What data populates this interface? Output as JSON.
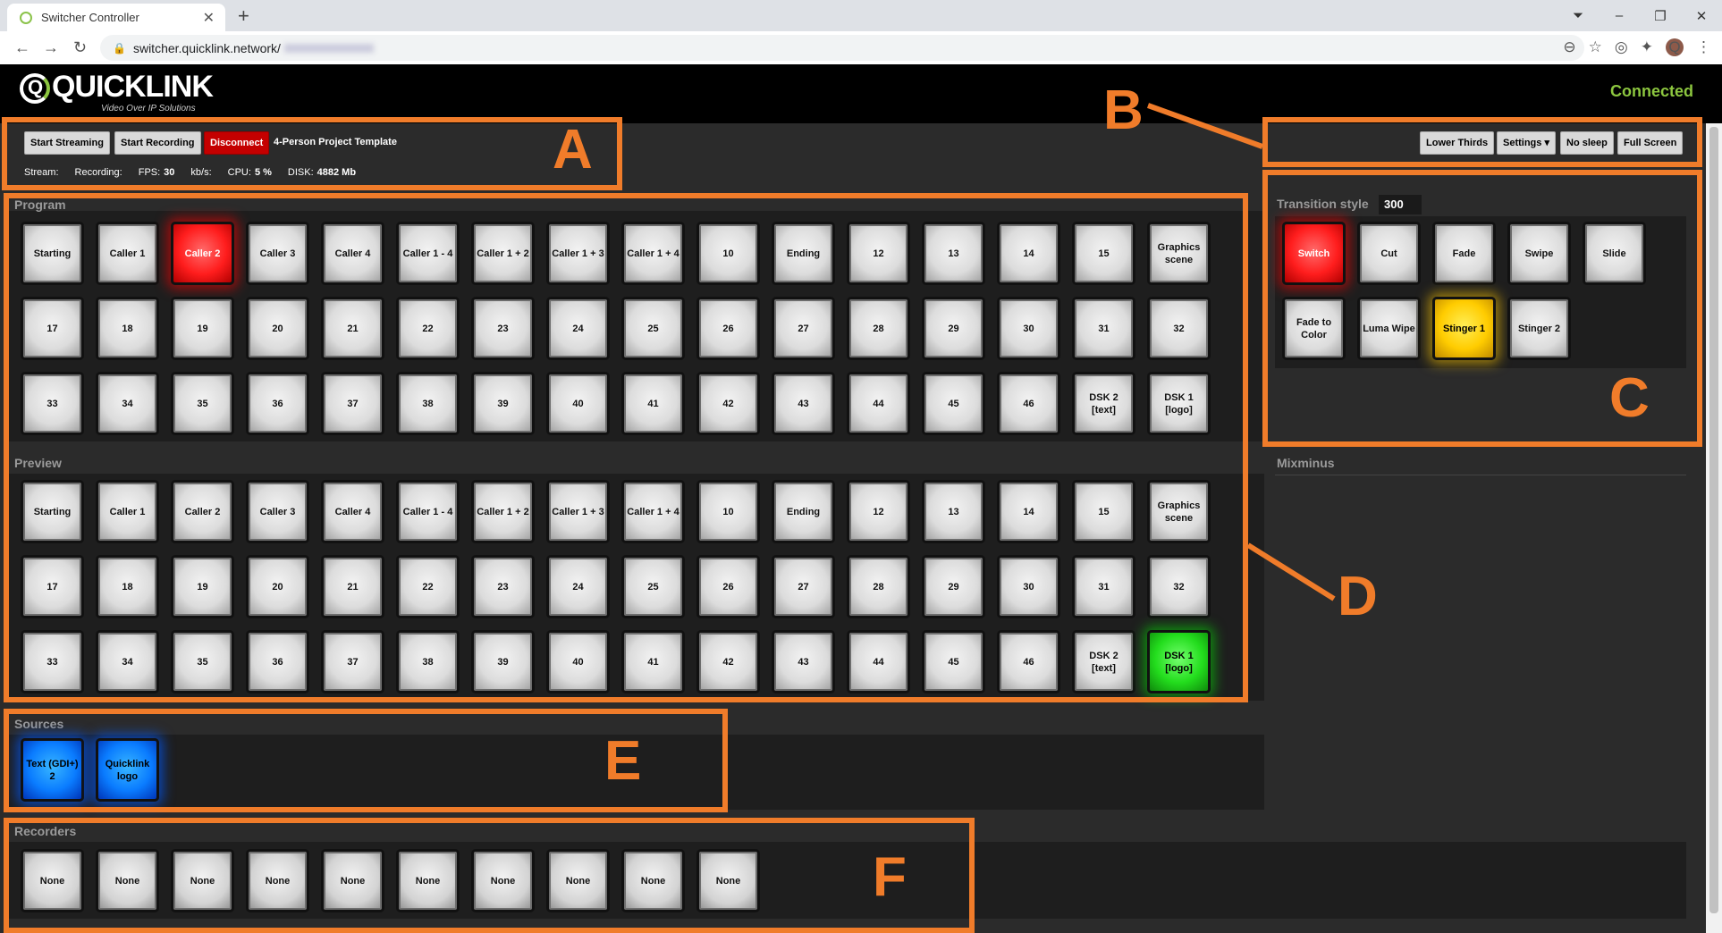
{
  "browser": {
    "tab_title": "Switcher Controller",
    "url": "switcher.quicklink.network/"
  },
  "app": {
    "logo_text": "QUICKLINK",
    "tagline": "Video Over IP Solutions",
    "status": "Connected"
  },
  "toolbar": {
    "start_streaming": "Start Streaming",
    "start_recording": "Start Recording",
    "disconnect": "Disconnect",
    "template": "4-Person Project Template",
    "lower_thirds": "Lower Thirds",
    "settings": "Settings",
    "no_sleep": "No sleep",
    "full_screen": "Full Screen"
  },
  "stats": {
    "stream_label": "Stream:",
    "recording_label": "Recording:",
    "fps_label": "FPS:",
    "fps_value": "30",
    "kbs_label": "kb/s:",
    "cpu_label": "CPU:",
    "cpu_value": "5 %",
    "disk_label": "DISK:",
    "disk_value": "4882 Mb"
  },
  "sections": {
    "program": "Program",
    "preview": "Preview",
    "sources": "Sources",
    "recorders": "Recorders",
    "transition_style": "Transition style",
    "transition_value": "300",
    "mixminus": "Mixminus"
  },
  "program": [
    [
      "Starting",
      "Caller 1",
      "Caller 2",
      "Caller 3",
      "Caller 4",
      "Caller 1 - 4",
      "Caller 1 + 2",
      "Caller 1 + 3",
      "Caller 1 + 4",
      "10",
      "Ending",
      "12",
      "13",
      "14",
      "15",
      "Graphics scene"
    ],
    [
      "17",
      "18",
      "19",
      "20",
      "21",
      "22",
      "23",
      "24",
      "25",
      "26",
      "27",
      "28",
      "29",
      "30",
      "31",
      "32"
    ],
    [
      "33",
      "34",
      "35",
      "36",
      "37",
      "38",
      "39",
      "40",
      "41",
      "42",
      "43",
      "44",
      "45",
      "46",
      "DSK 2 [text]",
      "DSK 1 [logo]"
    ]
  ],
  "preview": [
    [
      "Starting",
      "Caller 1",
      "Caller 2",
      "Caller 3",
      "Caller 4",
      "Caller 1 - 4",
      "Caller 1 + 2",
      "Caller 1 + 3",
      "Caller 1 + 4",
      "10",
      "Ending",
      "12",
      "13",
      "14",
      "15",
      "Graphics scene"
    ],
    [
      "17",
      "18",
      "19",
      "20",
      "21",
      "22",
      "23",
      "24",
      "25",
      "26",
      "27",
      "28",
      "29",
      "30",
      "31",
      "32"
    ],
    [
      "33",
      "34",
      "35",
      "36",
      "37",
      "38",
      "39",
      "40",
      "41",
      "42",
      "43",
      "44",
      "45",
      "46",
      "DSK 2 [text]",
      "DSK 1 [logo]"
    ]
  ],
  "program_active": "Caller 2",
  "preview_active": "DSK 1 [logo]",
  "transitions": [
    [
      "Switch",
      "Cut",
      "Fade",
      "Swipe",
      "Slide"
    ],
    [
      "Fade to Color",
      "Luma Wipe",
      "Stinger 1",
      "Stinger 2"
    ]
  ],
  "transition_active": [
    "Switch",
    "Stinger 1"
  ],
  "sources": [
    "Text (GDI+) 2",
    "Quicklink logo"
  ],
  "recorders": [
    "None",
    "None",
    "None",
    "None",
    "None",
    "None",
    "None",
    "None",
    "None",
    "None"
  ],
  "annotations": [
    "A",
    "B",
    "C",
    "D",
    "E",
    "F"
  ],
  "colors": {
    "accent_orange": "#f07c2a",
    "connected_green": "#8cc63f",
    "program_red": "#ff1d1d",
    "preview_green": "#23dd1d",
    "stinger_yellow": "#ffcc00",
    "source_blue": "#0a7cff"
  }
}
